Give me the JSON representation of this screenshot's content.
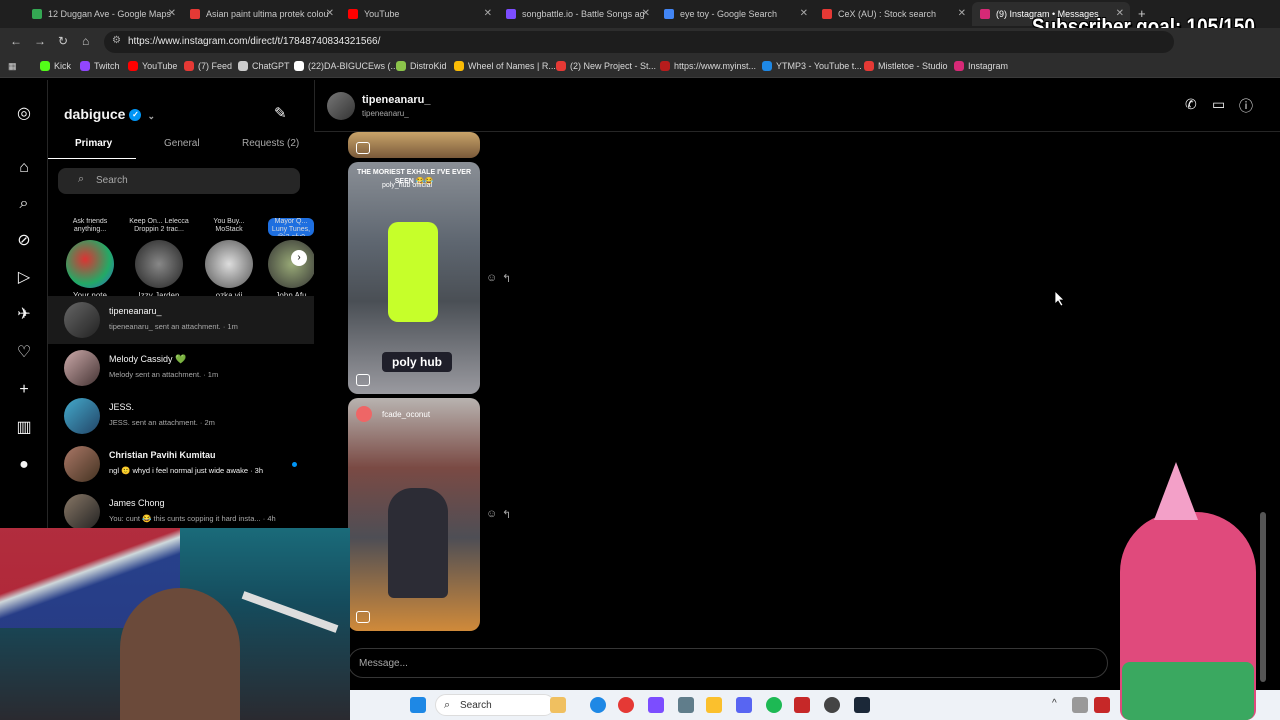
{
  "tabs": [
    {
      "label": "12 Duggan Ave - Google Maps",
      "color": "#34a853"
    },
    {
      "label": "Asian paint ultima protek colou",
      "color": "#e53935"
    },
    {
      "label": "YouTube",
      "color": "#ff0000"
    },
    {
      "label": "songbattle.io - Battle Songs ag",
      "color": "#7c4dff"
    },
    {
      "label": "eye toy - Google Search",
      "color": "#4285f4"
    },
    {
      "label": "CeX (AU) : Stock search",
      "color": "#e53935"
    },
    {
      "label": "(9) Instagram • Messages",
      "color": "#d62976"
    }
  ],
  "overlay": {
    "goal": "Subscriber goal: 105/150"
  },
  "url": "https://www.instagram.com/direct/t/17848740834321566/",
  "bookmarks": [
    {
      "label": "Kick",
      "color": "#53fc18"
    },
    {
      "label": "Twitch",
      "color": "#9146ff"
    },
    {
      "label": "YouTube",
      "color": "#ff0000"
    },
    {
      "label": "(7) Feed",
      "color": "#e53935"
    },
    {
      "label": "ChatGPT",
      "color": "#cccccc"
    },
    {
      "label": "(22)DA-BIGUCEws (...",
      "color": "#ffffff"
    },
    {
      "label": "DistroKid",
      "color": "#8bc34a"
    },
    {
      "label": "Wheel of Names | R...",
      "color": "#fbbc05"
    },
    {
      "label": "(2) New Project - St...",
      "color": "#e53935"
    },
    {
      "label": "https://www.myinst...",
      "color": "#b71c1c"
    },
    {
      "label": "YTMP3 - YouTube t...",
      "color": "#1e88e5"
    },
    {
      "label": "Mistletoe - Studio",
      "color": "#e53935"
    },
    {
      "label": "Instagram",
      "color": "#d62976"
    }
  ],
  "inbox": {
    "account": "dabiguce",
    "tabs": [
      "Primary",
      "General",
      "Requests (2)"
    ],
    "search_placeholder": "Search",
    "notes": [
      {
        "bubble": "Ask friends anything...",
        "name": "Your note"
      },
      {
        "bubble": "Keep On... Lelecca Droppin 2 trac...",
        "name": "Izzy Jarden"
      },
      {
        "bubble": "You Buy... MoStack",
        "name": "ozka.vii"
      },
      {
        "bubble": "Mayor Q... Luny Tunes, @j2.afu0",
        "name": "John Afu"
      }
    ],
    "conversations": [
      {
        "name": "tipeneanaru_",
        "preview": "tipeneanaru_ sent an attachment. · 1m"
      },
      {
        "name": "Melody Cassidy 💚",
        "preview": "Melody sent an attachment. · 1m"
      },
      {
        "name": "JESS.",
        "preview": "JESS. sent an attachment. · 2m"
      },
      {
        "name": "Christian Pavihi Kumitau",
        "preview": "ngl 🙂 whyd i feel normal just wide awake · 3h"
      },
      {
        "name": "James Chong",
        "preview": "You: cunt 😂 this cunts copping it hard insta... · 4h"
      }
    ]
  },
  "chat": {
    "name": "tipeneanaru_",
    "username": "tipeneanaru_",
    "reel1_caption": "THE MORIEST EXHALE I'VE EVER SEEN 😂😂",
    "reel1_account": "poly_hub official",
    "reel1_brand": "poly hub",
    "reel2_account": "fcade_oconut",
    "message_placeholder": "Message..."
  },
  "taskbar": {
    "search": "Search"
  }
}
